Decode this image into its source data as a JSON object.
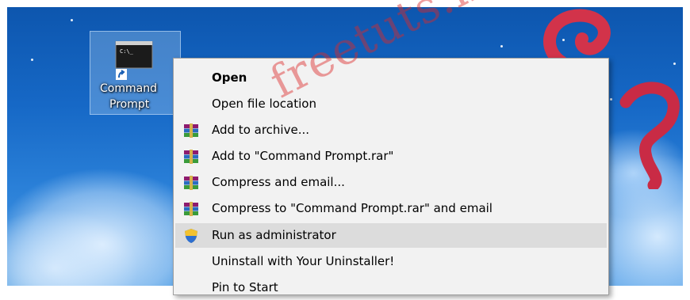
{
  "desktop_icon": {
    "label_line1": "Command",
    "label_line2": "Prompt",
    "thumb_text": "C:\\_"
  },
  "context_menu": {
    "items": [
      {
        "label": "Open",
        "bold": true,
        "icon": ""
      },
      {
        "label": "Open file location",
        "icon": ""
      },
      {
        "label": "Add to archive...",
        "icon": "winrar-icon"
      },
      {
        "label": "Add to \"Command Prompt.rar\"",
        "icon": "winrar-icon"
      },
      {
        "label": "Compress and email...",
        "icon": "winrar-icon"
      },
      {
        "label": "Compress to \"Command Prompt.rar\" and email",
        "icon": "winrar-icon"
      },
      {
        "label": "Run as administrator",
        "icon": "uac-shield-icon",
        "highlighted": true
      },
      {
        "label": "Uninstall with Your Uninstaller!",
        "icon": ""
      },
      {
        "label": "Pin to Start",
        "icon": ""
      }
    ]
  },
  "watermark": {
    "text": "freetuts.net"
  },
  "colors": {
    "menu_bg": "#f2f2f2",
    "hover": "#dcdcdc",
    "desktop": "#1668c6",
    "watermark": "#dc2828"
  }
}
